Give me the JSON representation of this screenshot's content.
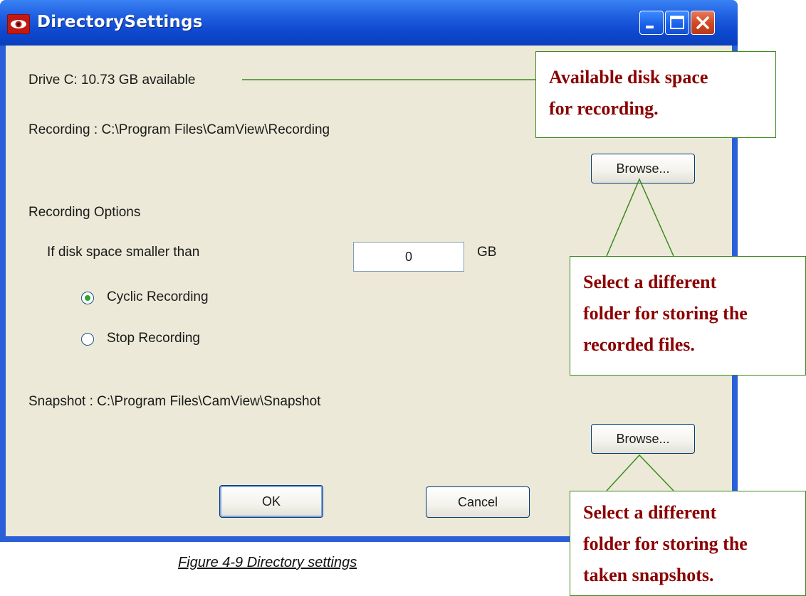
{
  "window": {
    "title": "DirectorySettings",
    "colors": {
      "titlebar": "#0d48cf",
      "client": "#ece9d8",
      "close": "#d2461f"
    }
  },
  "drive_info": "Drive C: 10.73 GB available",
  "recording": {
    "path_label": "Recording : C:\\Program Files\\CamView\\Recording",
    "browse_label": "Browse..."
  },
  "recording_options": {
    "heading": "Recording Options",
    "threshold_label": "If disk space smaller than",
    "threshold_value": "0",
    "threshold_unit": "GB",
    "radios": [
      {
        "label": "Cyclic Recording",
        "selected": true
      },
      {
        "label": "Stop Recording",
        "selected": false
      }
    ]
  },
  "snapshot": {
    "path_label": "Snapshot : C:\\Program Files\\CamView\\Snapshot",
    "browse_label": "Browse..."
  },
  "buttons": {
    "ok": "OK",
    "cancel": "Cancel"
  },
  "callouts": {
    "disk_space": [
      "Available disk space",
      "for recording."
    ],
    "recording_folder": [
      "Select a different",
      "folder for storing the",
      "recorded files."
    ],
    "snapshot_folder": [
      "Select a different",
      "folder for storing the",
      "taken snapshots."
    ],
    "colors": {
      "text": "#8b0000",
      "border": "#3a8a1c"
    }
  },
  "caption": "Figure 4-9 Directory settings"
}
